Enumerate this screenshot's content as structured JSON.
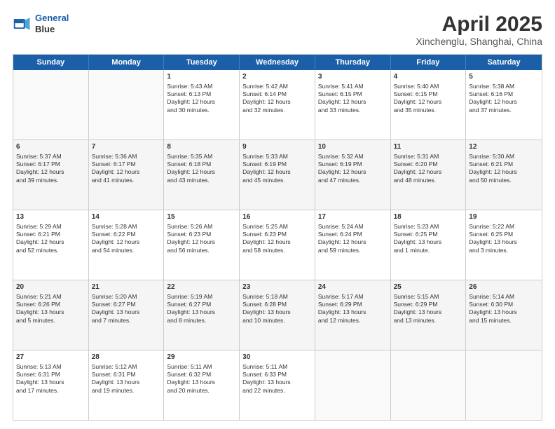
{
  "header": {
    "logo_line1": "General",
    "logo_line2": "Blue",
    "title": "April 2025",
    "subtitle": "Xinchenglu, Shanghai, China"
  },
  "weekdays": [
    "Sunday",
    "Monday",
    "Tuesday",
    "Wednesday",
    "Thursday",
    "Friday",
    "Saturday"
  ],
  "rows": [
    [
      {
        "day": "",
        "content": ""
      },
      {
        "day": "",
        "content": ""
      },
      {
        "day": "1",
        "content": "Sunrise: 5:43 AM\nSunset: 6:13 PM\nDaylight: 12 hours\nand 30 minutes."
      },
      {
        "day": "2",
        "content": "Sunrise: 5:42 AM\nSunset: 6:14 PM\nDaylight: 12 hours\nand 32 minutes."
      },
      {
        "day": "3",
        "content": "Sunrise: 5:41 AM\nSunset: 6:15 PM\nDaylight: 12 hours\nand 33 minutes."
      },
      {
        "day": "4",
        "content": "Sunrise: 5:40 AM\nSunset: 6:15 PM\nDaylight: 12 hours\nand 35 minutes."
      },
      {
        "day": "5",
        "content": "Sunrise: 5:38 AM\nSunset: 6:16 PM\nDaylight: 12 hours\nand 37 minutes."
      }
    ],
    [
      {
        "day": "6",
        "content": "Sunrise: 5:37 AM\nSunset: 6:17 PM\nDaylight: 12 hours\nand 39 minutes."
      },
      {
        "day": "7",
        "content": "Sunrise: 5:36 AM\nSunset: 6:17 PM\nDaylight: 12 hours\nand 41 minutes."
      },
      {
        "day": "8",
        "content": "Sunrise: 5:35 AM\nSunset: 6:18 PM\nDaylight: 12 hours\nand 43 minutes."
      },
      {
        "day": "9",
        "content": "Sunrise: 5:33 AM\nSunset: 6:19 PM\nDaylight: 12 hours\nand 45 minutes."
      },
      {
        "day": "10",
        "content": "Sunrise: 5:32 AM\nSunset: 6:19 PM\nDaylight: 12 hours\nand 47 minutes."
      },
      {
        "day": "11",
        "content": "Sunrise: 5:31 AM\nSunset: 6:20 PM\nDaylight: 12 hours\nand 48 minutes."
      },
      {
        "day": "12",
        "content": "Sunrise: 5:30 AM\nSunset: 6:21 PM\nDaylight: 12 hours\nand 50 minutes."
      }
    ],
    [
      {
        "day": "13",
        "content": "Sunrise: 5:29 AM\nSunset: 6:21 PM\nDaylight: 12 hours\nand 52 minutes."
      },
      {
        "day": "14",
        "content": "Sunrise: 5:28 AM\nSunset: 6:22 PM\nDaylight: 12 hours\nand 54 minutes."
      },
      {
        "day": "15",
        "content": "Sunrise: 5:26 AM\nSunset: 6:23 PM\nDaylight: 12 hours\nand 56 minutes."
      },
      {
        "day": "16",
        "content": "Sunrise: 5:25 AM\nSunset: 6:23 PM\nDaylight: 12 hours\nand 58 minutes."
      },
      {
        "day": "17",
        "content": "Sunrise: 5:24 AM\nSunset: 6:24 PM\nDaylight: 12 hours\nand 59 minutes."
      },
      {
        "day": "18",
        "content": "Sunrise: 5:23 AM\nSunset: 6:25 PM\nDaylight: 13 hours\nand 1 minute."
      },
      {
        "day": "19",
        "content": "Sunrise: 5:22 AM\nSunset: 6:25 PM\nDaylight: 13 hours\nand 3 minutes."
      }
    ],
    [
      {
        "day": "20",
        "content": "Sunrise: 5:21 AM\nSunset: 6:26 PM\nDaylight: 13 hours\nand 5 minutes."
      },
      {
        "day": "21",
        "content": "Sunrise: 5:20 AM\nSunset: 6:27 PM\nDaylight: 13 hours\nand 7 minutes."
      },
      {
        "day": "22",
        "content": "Sunrise: 5:19 AM\nSunset: 6:27 PM\nDaylight: 13 hours\nand 8 minutes."
      },
      {
        "day": "23",
        "content": "Sunrise: 5:18 AM\nSunset: 6:28 PM\nDaylight: 13 hours\nand 10 minutes."
      },
      {
        "day": "24",
        "content": "Sunrise: 5:17 AM\nSunset: 6:29 PM\nDaylight: 13 hours\nand 12 minutes."
      },
      {
        "day": "25",
        "content": "Sunrise: 5:15 AM\nSunset: 6:29 PM\nDaylight: 13 hours\nand 13 minutes."
      },
      {
        "day": "26",
        "content": "Sunrise: 5:14 AM\nSunset: 6:30 PM\nDaylight: 13 hours\nand 15 minutes."
      }
    ],
    [
      {
        "day": "27",
        "content": "Sunrise: 5:13 AM\nSunset: 6:31 PM\nDaylight: 13 hours\nand 17 minutes."
      },
      {
        "day": "28",
        "content": "Sunrise: 5:12 AM\nSunset: 6:31 PM\nDaylight: 13 hours\nand 19 minutes."
      },
      {
        "day": "29",
        "content": "Sunrise: 5:11 AM\nSunset: 6:32 PM\nDaylight: 13 hours\nand 20 minutes."
      },
      {
        "day": "30",
        "content": "Sunrise: 5:11 AM\nSunset: 6:33 PM\nDaylight: 13 hours\nand 22 minutes."
      },
      {
        "day": "",
        "content": ""
      },
      {
        "day": "",
        "content": ""
      },
      {
        "day": "",
        "content": ""
      }
    ]
  ]
}
